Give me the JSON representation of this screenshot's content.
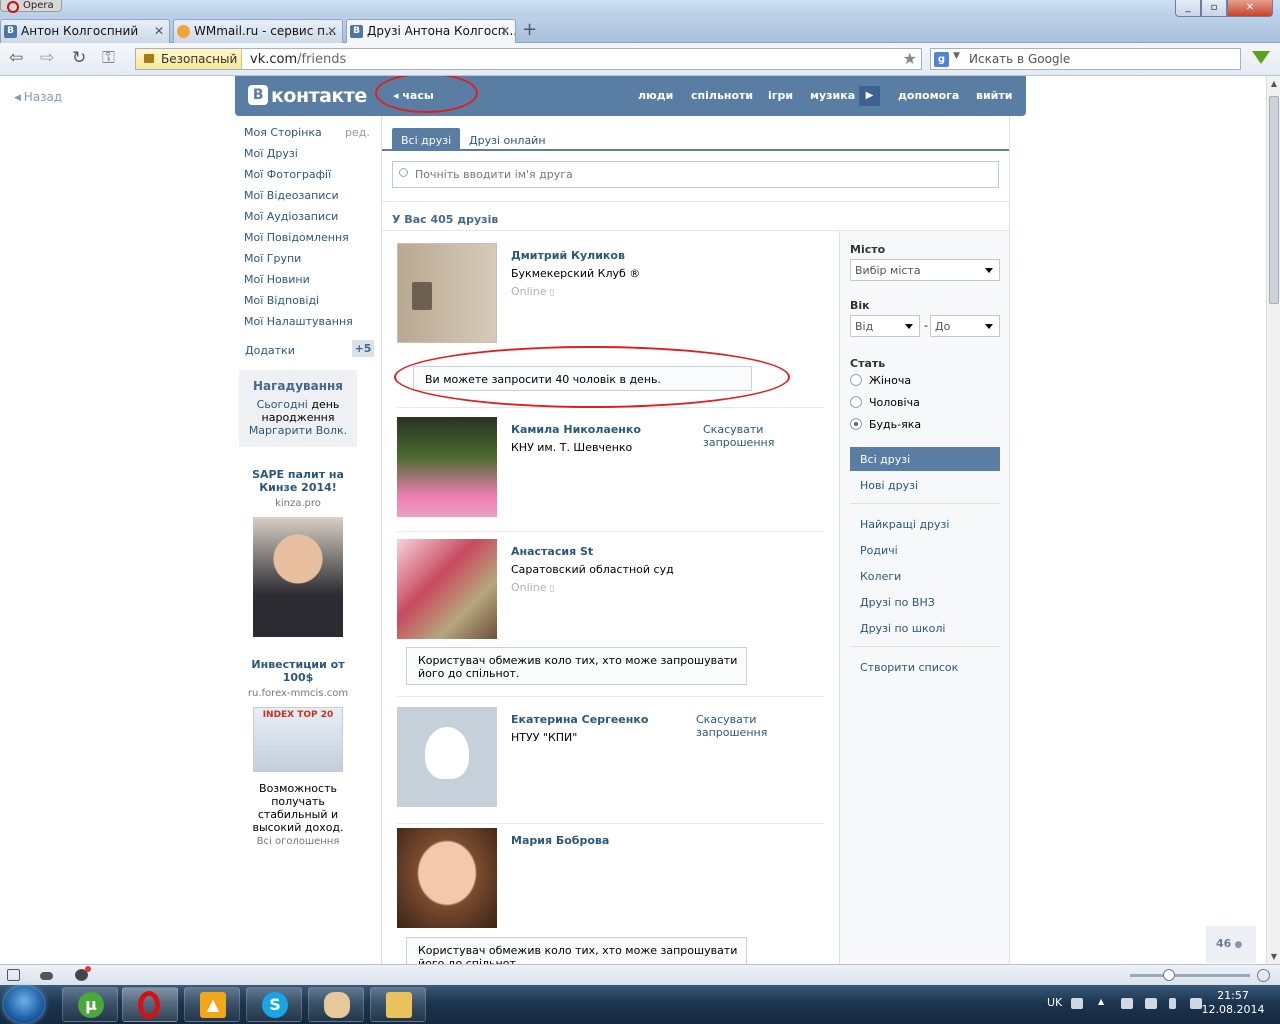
{
  "browser": {
    "menu_label": "Opera",
    "tabs": [
      {
        "title": "Антон Колгоспний",
        "favicon": "В"
      },
      {
        "title": "WMmail.ru - сервис п...",
        "favicon": ""
      },
      {
        "title": "Друзі Антона Колгосп...",
        "favicon": "В"
      }
    ],
    "secure_label": "Безопасный",
    "url_host": "vk.com",
    "url_path": "/friends",
    "search_placeholder": "Искать в Google",
    "search_engine_letter": "g"
  },
  "page": {
    "back_label": "Назад",
    "logo_letter": "В",
    "logo_text": "контакте",
    "clock_label": "часы",
    "nav": {
      "people": "люди",
      "communities": "спільноти",
      "games": "ігри",
      "music": "музика",
      "help": "допомога",
      "logout": "вийти"
    },
    "left_menu": [
      "Моя Сторінка",
      "Мої Друзі",
      "Мої Фотографії",
      "Мої Відеозаписи",
      "Мої Аудіозаписи",
      "Мої Повідомлення",
      "Мої Групи",
      "Мої Новини",
      "Мої Відповіді",
      "Мої Налаштування"
    ],
    "edit_label": "ред.",
    "apps_label": "Додатки",
    "apps_badge": "+5",
    "reminder": {
      "title": "Нагадування",
      "line1_link": "Сьогодні",
      "line1_rest": " день народження ",
      "line2_link": "Маргарити Волк."
    },
    "ads": [
      {
        "title": "SAPE палит на Кинзе 2014!",
        "domain": "kinza.pro"
      },
      {
        "title": "Инвестиции от 100$",
        "domain": "ru.forex-mmcis.com",
        "description": "Возможность получать стабильный и высокий доход."
      }
    ],
    "all_ads_label": "Всі оголошення",
    "tabs": {
      "all": "Всі друзі",
      "online": "Друзі онлайн"
    },
    "search_placeholder": "Почніть вводити ім'я друга",
    "friend_count": "У Вас 405 друзів",
    "friends": [
      {
        "name": "Дмитрий Куликов",
        "sub": "Букмекерский Клуб ®",
        "status": "Online"
      },
      {
        "name": "Камила Николаенко",
        "sub": "КНУ им. Т. Шевченко",
        "action": "Скасувати запрошення"
      },
      {
        "name": "Анастасия St",
        "sub": "Саратовский областной суд",
        "status": "Online"
      },
      {
        "name": "Екатерина Сергеенко",
        "sub": "НТУУ \"КПИ\"",
        "action": "Скасувати запрошення"
      },
      {
        "name": "Мария Боброва"
      }
    ],
    "notices": {
      "invite_limit": "Ви можете запросити 40 чоловік в день.",
      "restricted": "Користувач обмежив коло тих, хто може запрошувати його до спільнот."
    },
    "filter": {
      "city_label": "Місто",
      "city_value": "Вибір міста",
      "age_label": "Вік",
      "age_from": "Від",
      "age_dash": "-",
      "age_to": "До",
      "sex_label": "Стать",
      "sex_options": [
        "Жіноча",
        "Чоловіча",
        "Будь-яка"
      ],
      "lists": [
        "Всі друзі",
        "Нові друзі"
      ],
      "groups": [
        "Найкращі друзі",
        "Родичі",
        "Колеги",
        "Друзі по ВНЗ",
        "Друзі по школі"
      ],
      "create_list": "Створити список"
    },
    "online_counter": "46"
  },
  "taskbar": {
    "language": "UK",
    "time": "21:57",
    "date": "12.08.2014",
    "apps": [
      "utorrent-icon",
      "opera-icon",
      "aimp-icon",
      "skype-icon",
      "paint-icon",
      "explorer-icon"
    ]
  },
  "colors": {
    "vk_blue": "#597da3",
    "link": "#2b587a",
    "annotation_red": "#e01e1e"
  }
}
